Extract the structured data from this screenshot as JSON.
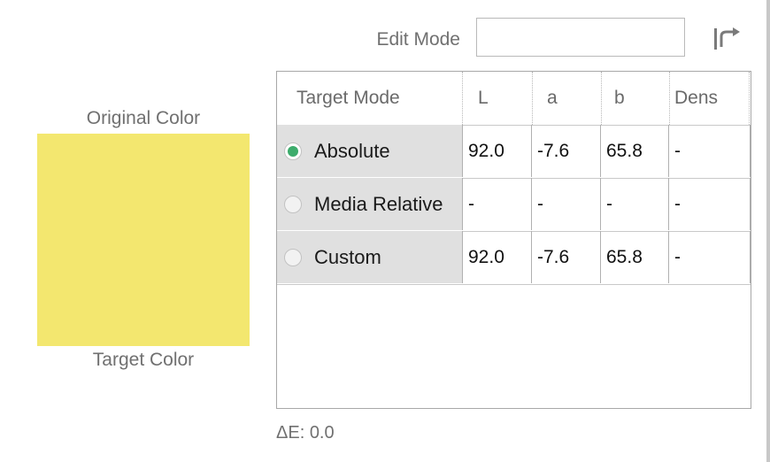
{
  "edit_mode": {
    "label": "Edit Mode",
    "value": "",
    "placeholder": ""
  },
  "labels": {
    "original": "Original Color",
    "target": "Target Color"
  },
  "swatch_color": "#f3e76f",
  "accent_color": "#3dac6c",
  "table": {
    "headers": [
      "Target Mode",
      "L",
      "a",
      "b",
      "Dens"
    ],
    "rows": [
      {
        "mode": "Absolute",
        "selected": true,
        "L": "92.0",
        "a": "-7.6",
        "b": "65.8",
        "dens": "-"
      },
      {
        "mode": "Media Relative",
        "selected": false,
        "L": "-",
        "a": "-",
        "b": "-",
        "dens": "-"
      },
      {
        "mode": "Custom",
        "selected": false,
        "L": "92.0",
        "a": "-7.6",
        "b": "65.8",
        "dens": "-"
      }
    ]
  },
  "delta_e": "ΔE: 0.0",
  "icons": {
    "undo": "undo-icon"
  }
}
